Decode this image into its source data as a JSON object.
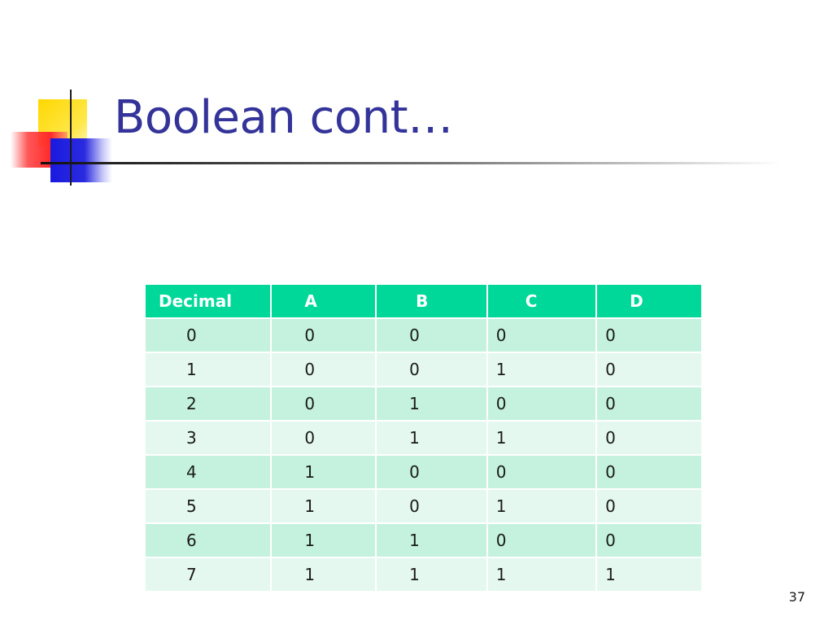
{
  "slide": {
    "title": "Boolean cont…",
    "page_number": "37"
  },
  "table": {
    "headers": [
      "Decimal",
      "A",
      "B",
      "C",
      "D"
    ],
    "rows": [
      [
        "0",
        "0",
        "0",
        "0",
        "0"
      ],
      [
        "1",
        "0",
        "0",
        "1",
        "0"
      ],
      [
        "2",
        "0",
        "1",
        "0",
        "0"
      ],
      [
        "3",
        "0",
        "1",
        "1",
        "0"
      ],
      [
        "4",
        "1",
        "0",
        "0",
        "0"
      ],
      [
        "5",
        "1",
        "0",
        "1",
        "0"
      ],
      [
        "6",
        "1",
        "1",
        "0",
        "0"
      ],
      [
        "7",
        "1",
        "1",
        "1",
        "1"
      ]
    ]
  },
  "colors": {
    "title": "#333399",
    "header_bg": "#00d89a",
    "row_odd_bg": "#c4f2de",
    "row_even_bg": "#e4f8ef",
    "logo_yellow": "#ffd700",
    "logo_red": "#ff2a2a",
    "logo_blue": "#1a1adf"
  }
}
